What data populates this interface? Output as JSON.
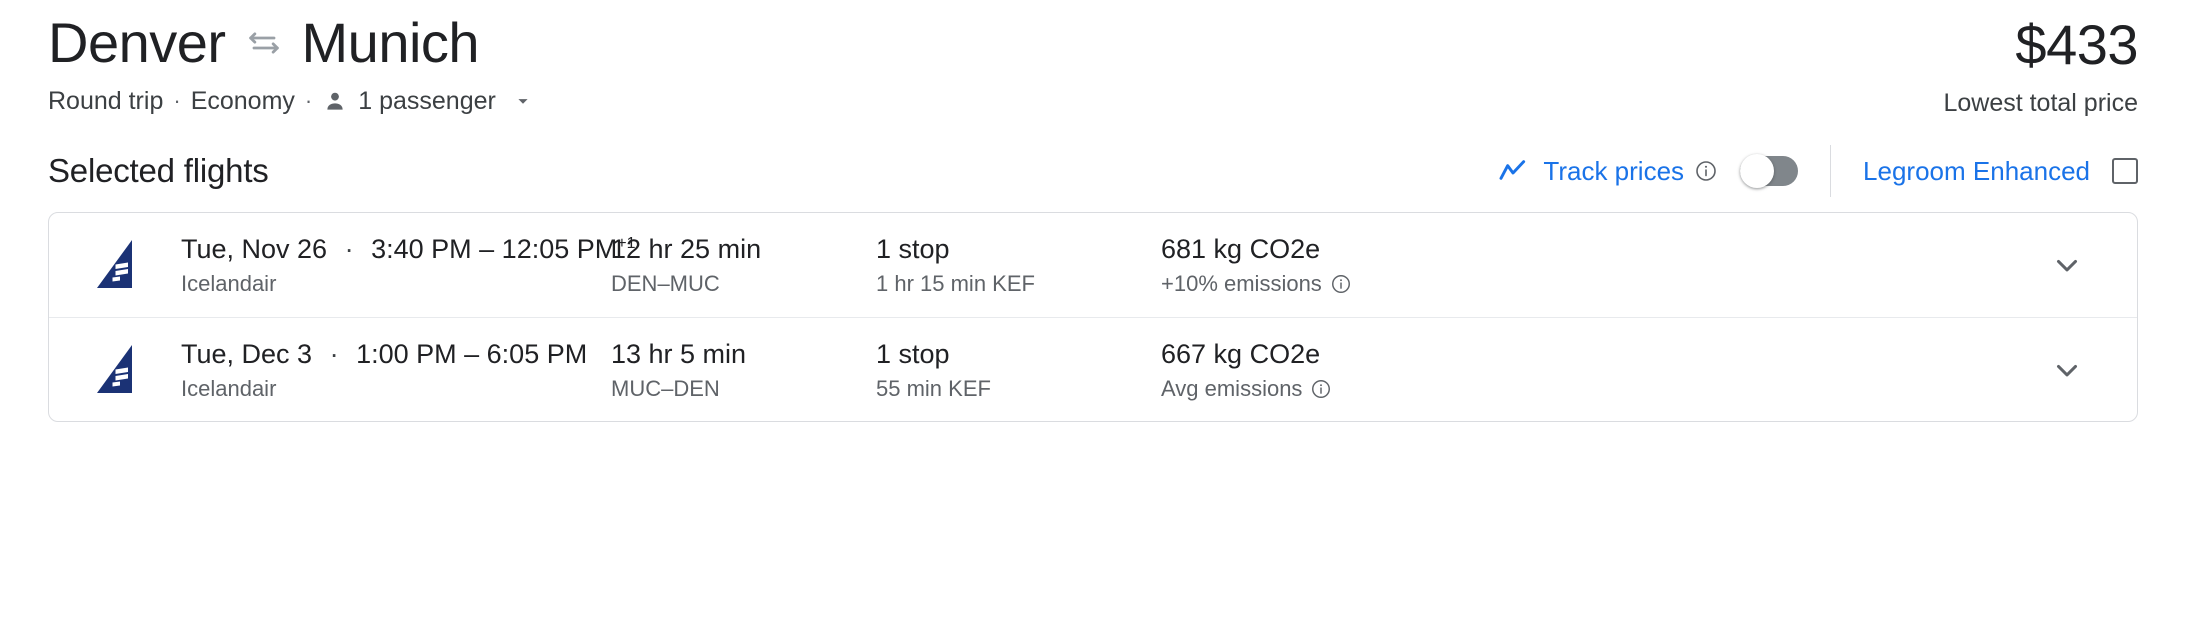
{
  "header": {
    "origin": "Denver",
    "destination": "Munich",
    "swap_icon": "swap-horizontal-icon",
    "trip_type": "Round trip",
    "cabin_class": "Economy",
    "passengers": "1 passenger",
    "separator": "·",
    "person_icon": "person-icon",
    "caret_icon": "chevron-down-icon",
    "price": "$433",
    "price_note": "Lowest total price"
  },
  "section": {
    "title": "Selected flights",
    "track_prices_label": "Track prices",
    "track_prices_icon": "trending-chart-icon",
    "track_prices_info_icon": "info-icon",
    "track_prices_toggle_state": "off",
    "legroom_label": "Legroom Enhanced",
    "legroom_checked": "false"
  },
  "colors": {
    "accent_blue": "#1a73e8",
    "text_primary": "#202124",
    "text_secondary": "#5f6368",
    "border": "#dadce0",
    "airline_navy": "#1b3275"
  },
  "flights": [
    {
      "airline_logo": "icelandair-tail-logo",
      "date": "Tue, Nov 26",
      "separator": "·",
      "times": "3:40 PM – 12:05 PM",
      "day_offset": "+1",
      "airline": "Icelandair",
      "duration": "12 hr 25 min",
      "route": "DEN–MUC",
      "stops": "1 stop",
      "layover": "1 hr 15 min KEF",
      "emissions": "681 kg CO2e",
      "emissions_note": "+10% emissions",
      "emissions_info_icon": "info-icon",
      "expand_icon": "chevron-down-icon"
    },
    {
      "airline_logo": "icelandair-tail-logo",
      "date": "Tue, Dec 3",
      "separator": "·",
      "times": "1:00 PM – 6:05 PM",
      "day_offset": "",
      "airline": "Icelandair",
      "duration": "13 hr 5 min",
      "route": "MUC–DEN",
      "stops": "1 stop",
      "layover": "55 min KEF",
      "emissions": "667 kg CO2e",
      "emissions_note": "Avg emissions",
      "emissions_info_icon": "info-icon",
      "expand_icon": "chevron-down-icon"
    }
  ]
}
